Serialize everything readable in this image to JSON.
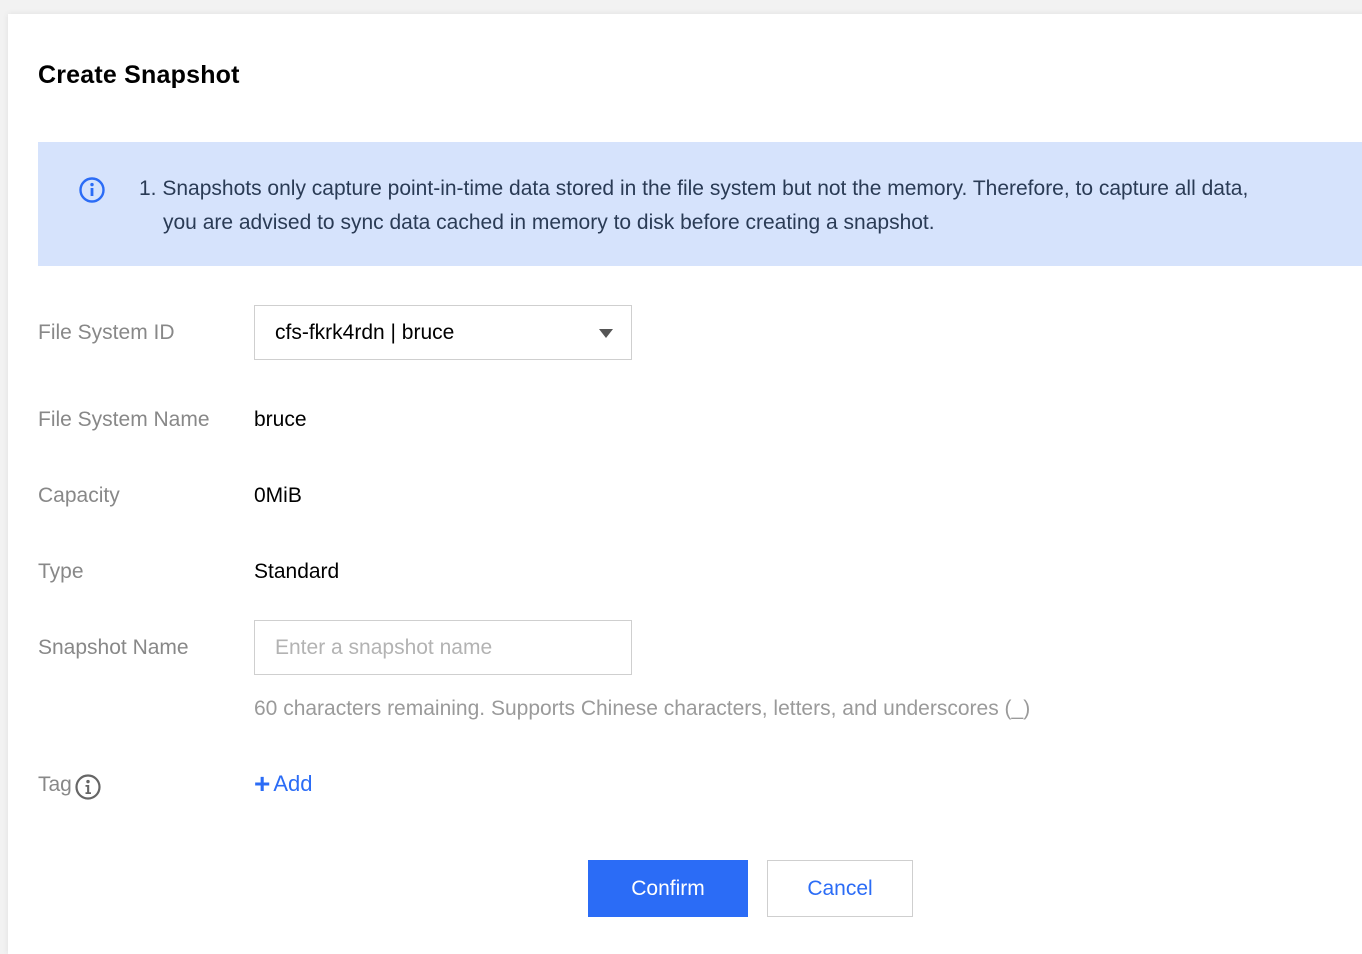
{
  "dialog": {
    "title": "Create Snapshot",
    "notice": {
      "icon": "info-icon",
      "line1": "1. Snapshots only capture point-in-time data stored in the file system but not the memory. Therefore, to capture all data,",
      "line2": "you are advised to sync data cached in memory to disk before creating a snapshot."
    },
    "fields": {
      "file_system_id": {
        "label": "File System ID",
        "selected": "cfs-fkrk4rdn | bruce"
      },
      "file_system_name": {
        "label": "File System Name",
        "value": "bruce"
      },
      "capacity": {
        "label": "Capacity",
        "value": "0MiB"
      },
      "type": {
        "label": "Type",
        "value": "Standard"
      },
      "snapshot_name": {
        "label": "Snapshot Name",
        "value": "",
        "placeholder": "Enter a snapshot name",
        "hint": "60 characters remaining. Supports Chinese characters, letters, and underscores (_)"
      },
      "tag": {
        "label": "Tag",
        "icon": "info-icon",
        "add_label": "Add"
      }
    },
    "buttons": {
      "confirm": "Confirm",
      "cancel": "Cancel"
    }
  },
  "colors": {
    "primary": "#2b6cf6",
    "notice_bg": "#d6e3fc",
    "label": "#888888"
  }
}
